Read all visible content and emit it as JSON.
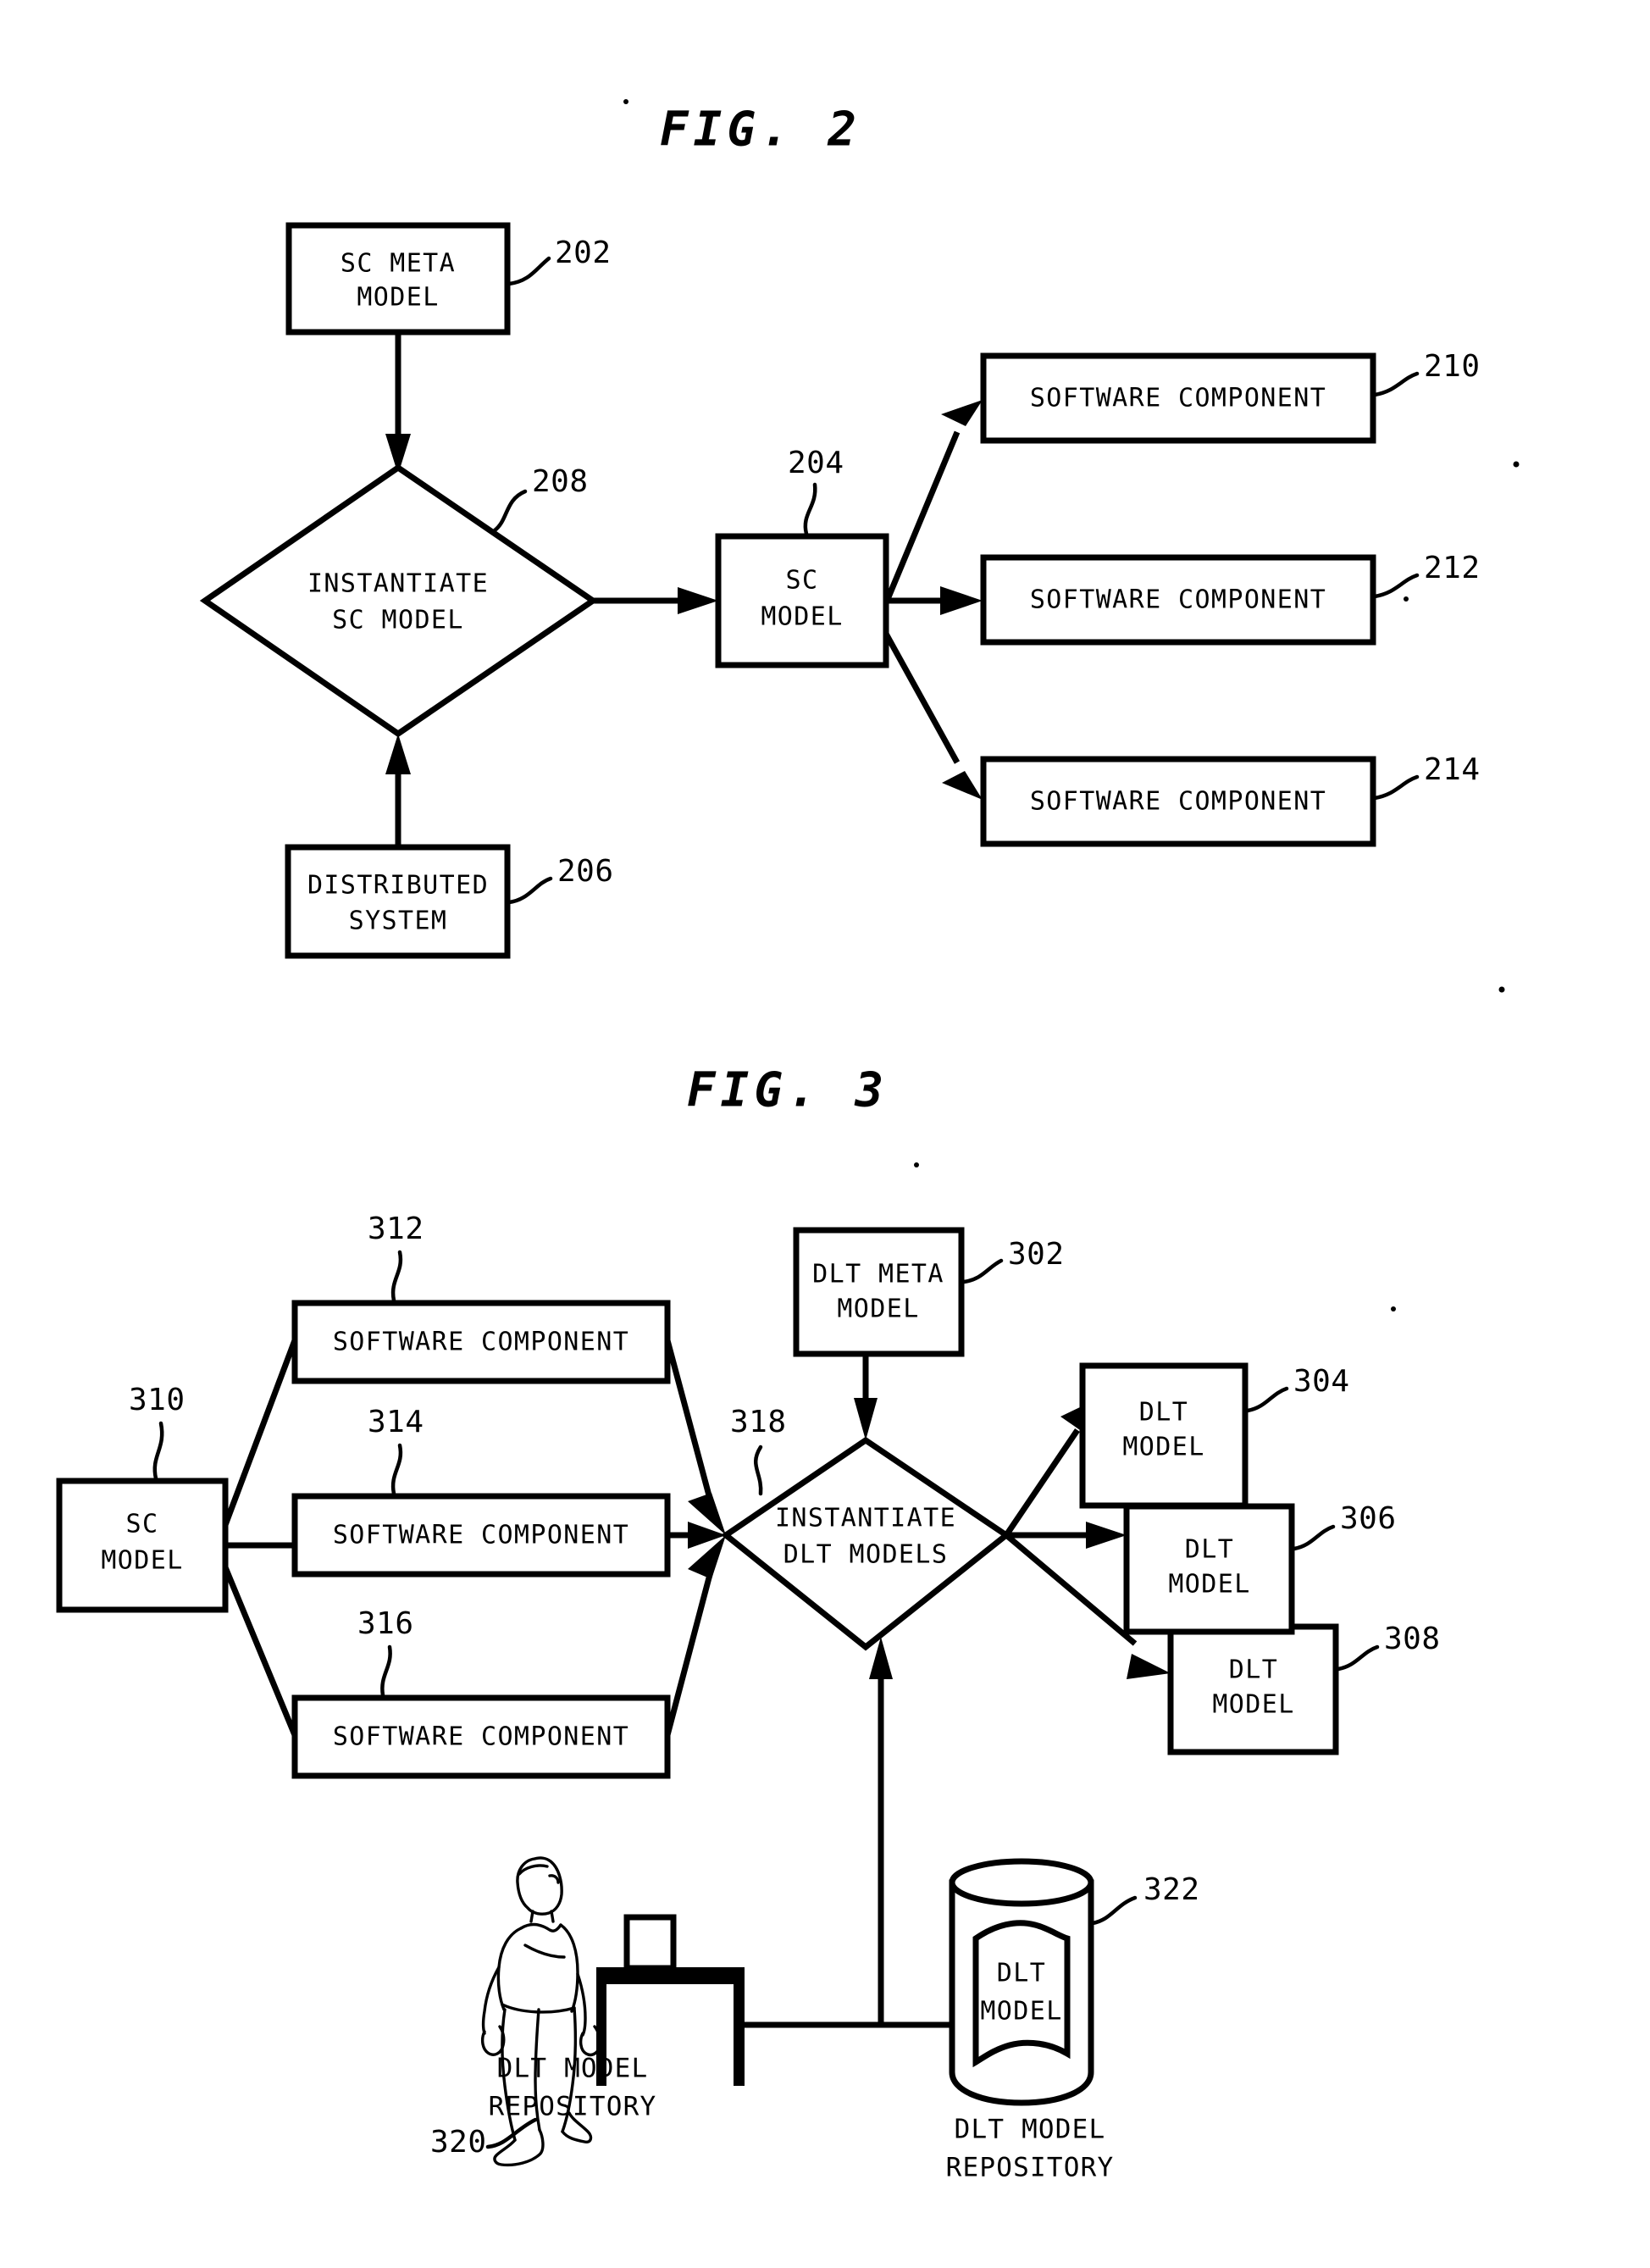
{
  "document": {
    "type": "patent-drawing-sheet",
    "figures": [
      {
        "id": "fig2",
        "title": "FIG. 2",
        "nodes": [
          {
            "ref": "202",
            "shape": "rectangle",
            "lines": [
              "SC META",
              "MODEL"
            ]
          },
          {
            "ref": "208",
            "shape": "diamond",
            "lines": [
              "INSTANTIATE",
              "SC MODEL"
            ]
          },
          {
            "ref": "206",
            "shape": "rectangle",
            "lines": [
              "DISTRIBUTED",
              "SYSTEM"
            ]
          },
          {
            "ref": "204",
            "shape": "rectangle",
            "lines": [
              "SC",
              "MODEL"
            ]
          },
          {
            "ref": "210",
            "shape": "rectangle",
            "lines": [
              "SOFTWARE COMPONENT"
            ]
          },
          {
            "ref": "212",
            "shape": "rectangle",
            "lines": [
              "SOFTWARE COMPONENT"
            ]
          },
          {
            "ref": "214",
            "shape": "rectangle",
            "lines": [
              "SOFTWARE COMPONENT"
            ]
          }
        ]
      },
      {
        "id": "fig3",
        "title": "FIG. 3",
        "nodes": [
          {
            "ref": "310",
            "shape": "rectangle",
            "lines": [
              "SC",
              "MODEL"
            ]
          },
          {
            "ref": "312",
            "shape": "rectangle",
            "lines": [
              "SOFTWARE COMPONENT"
            ]
          },
          {
            "ref": "314",
            "shape": "rectangle",
            "lines": [
              "SOFTWARE COMPONENT"
            ]
          },
          {
            "ref": "316",
            "shape": "rectangle",
            "lines": [
              "SOFTWARE COMPONENT"
            ]
          },
          {
            "ref": "302",
            "shape": "rectangle",
            "lines": [
              "DLT META",
              "MODEL"
            ]
          },
          {
            "ref": "318",
            "shape": "diamond",
            "lines": [
              "INSTANTIATE",
              "DLT MODELS"
            ]
          },
          {
            "ref": "304",
            "shape": "rectangle",
            "lines": [
              "DLT",
              "MODEL"
            ]
          },
          {
            "ref": "306",
            "shape": "rectangle",
            "lines": [
              "DLT",
              "MODEL"
            ]
          },
          {
            "ref": "308",
            "shape": "rectangle",
            "lines": [
              "DLT",
              "MODEL"
            ]
          },
          {
            "ref": "320",
            "shape": "person-and-desk",
            "caption": [
              "DLT MODEL",
              "REPOSITORY"
            ]
          },
          {
            "ref": "322",
            "shape": "cylinder",
            "lines": [
              "DLT",
              "MODEL"
            ],
            "caption": [
              "DLT MODEL",
              "REPOSITORY"
            ]
          }
        ]
      }
    ]
  },
  "fig2": {
    "title": "FIG. 2",
    "sc_meta_model": {
      "line1": "SC META",
      "line2": "MODEL",
      "ref": "202"
    },
    "instantiate": {
      "line1": "INSTANTIATE",
      "line2": "SC MODEL",
      "ref": "208"
    },
    "distributed_system": {
      "line1": "DISTRIBUTED",
      "line2": "SYSTEM",
      "ref": "206"
    },
    "sc_model": {
      "line1": "SC",
      "line2": "MODEL",
      "ref": "204"
    },
    "component_1": {
      "label": "SOFTWARE COMPONENT",
      "ref": "210"
    },
    "component_2": {
      "label": "SOFTWARE COMPONENT",
      "ref": "212"
    },
    "component_3": {
      "label": "SOFTWARE COMPONENT",
      "ref": "214"
    }
  },
  "fig3": {
    "title": "FIG. 3",
    "sc_model": {
      "line1": "SC",
      "line2": "MODEL",
      "ref": "310"
    },
    "component_1": {
      "label": "SOFTWARE COMPONENT",
      "ref": "312"
    },
    "component_2": {
      "label": "SOFTWARE COMPONENT",
      "ref": "314"
    },
    "component_3": {
      "label": "SOFTWARE COMPONENT",
      "ref": "316"
    },
    "dlt_meta_model": {
      "line1": "DLT META",
      "line2": "MODEL",
      "ref": "302"
    },
    "instantiate": {
      "line1": "INSTANTIATE",
      "line2": "DLT MODELS",
      "ref": "318"
    },
    "dlt_model_1": {
      "line1": "DLT",
      "line2": "MODEL",
      "ref": "304"
    },
    "dlt_model_2": {
      "line1": "DLT",
      "line2": "MODEL",
      "ref": "306"
    },
    "dlt_model_3": {
      "line1": "DLT",
      "line2": "MODEL",
      "ref": "308"
    },
    "workstation_repository": {
      "caption1": "DLT MODEL",
      "caption2": "REPOSITORY",
      "ref": "320"
    },
    "database_repository": {
      "inner1": "DLT",
      "inner2": "MODEL",
      "caption1": "DLT MODEL",
      "caption2": "REPOSITORY",
      "ref": "322"
    }
  },
  "colors": {
    "ink": "#000000",
    "paper": "#ffffff"
  }
}
